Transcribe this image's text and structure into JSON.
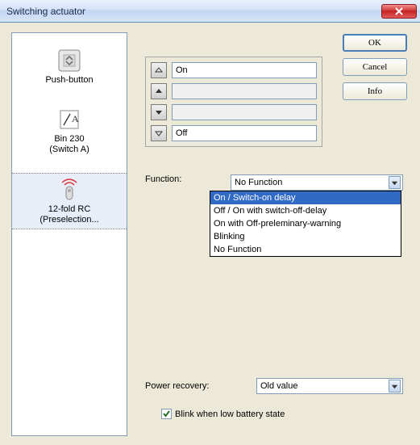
{
  "window": {
    "title": "Switching actuator"
  },
  "buttons": {
    "ok": "OK",
    "cancel": "Cancel",
    "info": "Info",
    "close": "X"
  },
  "sidebar": {
    "items": [
      {
        "label": "Push-button"
      },
      {
        "label1": "Bin 230",
        "label2": "(Switch A)"
      },
      {
        "label1": "12-fold RC",
        "label2": "(Preselection..."
      }
    ]
  },
  "rows": {
    "up_on": "On",
    "up_blank": "",
    "down_blank": "",
    "down_off": "Off"
  },
  "function": {
    "label": "Function:",
    "value": "No Function",
    "options": [
      "On / Switch-on delay",
      "Off / On with switch-off-delay",
      "On with Off-preleminary-warning",
      "Blinking",
      "No Function"
    ]
  },
  "power_recovery": {
    "label": "Power recovery:",
    "value": "Old value"
  },
  "blink_checkbox": {
    "label": "Blink when low battery state",
    "checked": true
  }
}
